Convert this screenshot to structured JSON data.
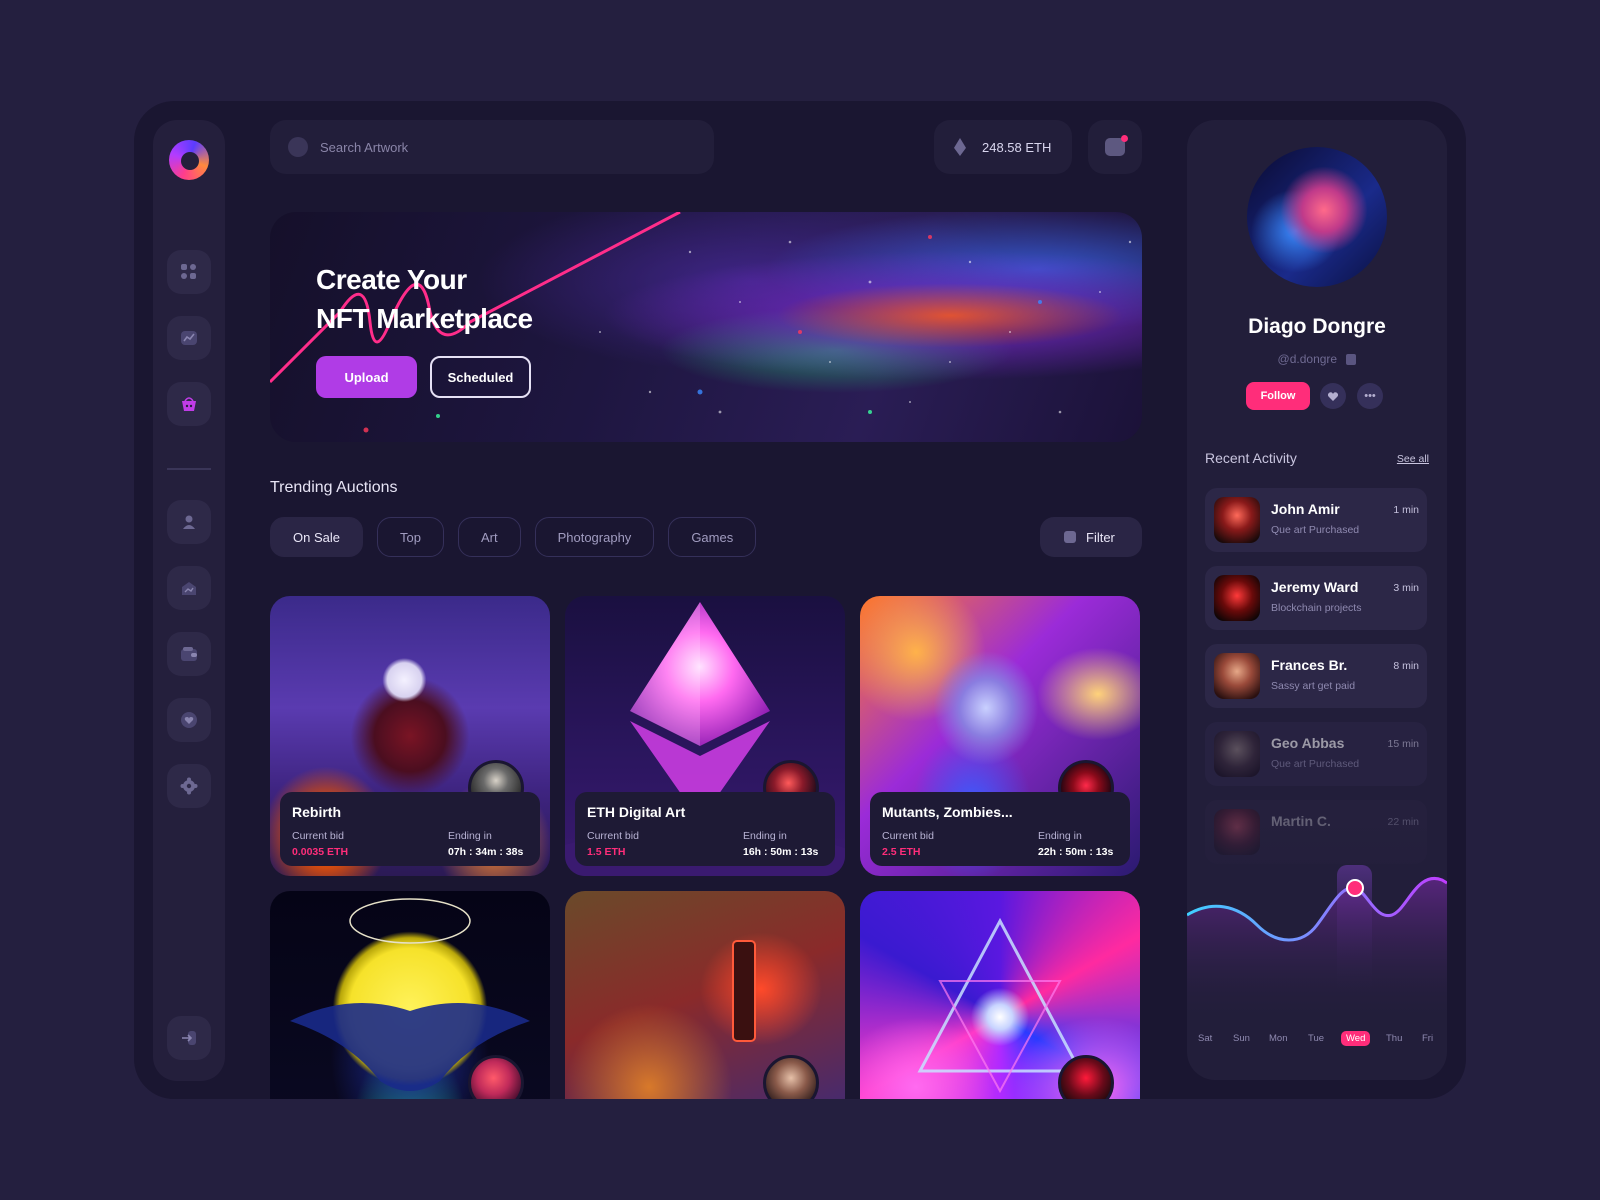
{
  "search": {
    "placeholder": "Search Artwork"
  },
  "wallet": {
    "balance": "248.58 ETH"
  },
  "hero": {
    "title_line1": "Create Your",
    "title_line2": "NFT Marketplace",
    "upload_label": "Upload",
    "scheduled_label": "Scheduled"
  },
  "trending": {
    "title": "Trending Auctions",
    "chips": [
      "On Sale",
      "Top",
      "Art",
      "Photography",
      "Games"
    ],
    "filter_label": "Filter"
  },
  "cards": [
    {
      "name": "Rebirth",
      "bid_label": "Current bid",
      "bid": "0.0035 ETH",
      "ending_label": "Ending in",
      "ending": "07h : 34m : 38s"
    },
    {
      "name": "ETH Digital Art",
      "bid_label": "Current bid",
      "bid": "1.5 ETH",
      "ending_label": "Ending in",
      "ending": "16h : 50m : 13s"
    },
    {
      "name": "Mutants, Zombies...",
      "bid_label": "Current bid",
      "bid": "2.5 ETH",
      "ending_label": "Ending in",
      "ending": "22h : 50m : 13s"
    }
  ],
  "profile": {
    "name": "Diago Dongre",
    "handle": "@d.dongre",
    "follow_label": "Follow",
    "more_label": "•••"
  },
  "recent_activity": {
    "title": "Recent Activity",
    "see_all": "See all",
    "items": [
      {
        "name": "John Amir",
        "desc": "Que art Purchased",
        "time": "1 min"
      },
      {
        "name": "Jeremy Ward",
        "desc": "Blockchain projects",
        "time": "3 min"
      },
      {
        "name": "Frances Br.",
        "desc": "Sassy art get paid",
        "time": "8 min"
      },
      {
        "name": "Geo Abbas",
        "desc": "Que art Purchased",
        "time": "15 min"
      },
      {
        "name": "Martin C.",
        "desc": "",
        "time": "22 min"
      }
    ]
  },
  "activity_chart": {
    "days": [
      "Sat",
      "Sun",
      "Mon",
      "Tue",
      "Wed",
      "Thu",
      "Fri"
    ],
    "selected_day": "Wed",
    "colors": {
      "line_start": "#3fd0ff",
      "line_end": "#c03cff",
      "marker": "#ff2d7a"
    }
  }
}
